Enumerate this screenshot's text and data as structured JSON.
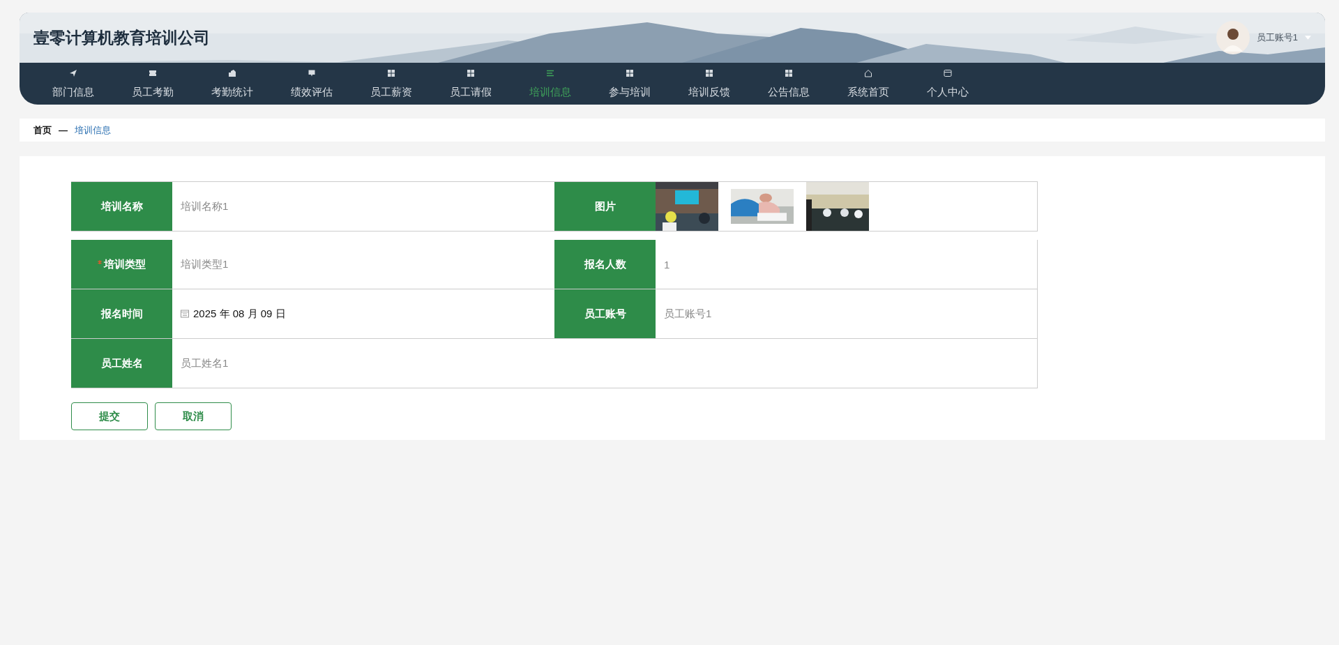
{
  "header": {
    "title": "壹零计算机教育培训公司",
    "user": {
      "name": "员工账号1"
    }
  },
  "nav": [
    {
      "label": "部门信息",
      "selected": false
    },
    {
      "label": "员工考勤",
      "selected": false
    },
    {
      "label": "考勤统计",
      "selected": false
    },
    {
      "label": "绩效评估",
      "selected": false
    },
    {
      "label": "员工薪资",
      "selected": false
    },
    {
      "label": "员工请假",
      "selected": false
    },
    {
      "label": "培训信息",
      "selected": true
    },
    {
      "label": "参与培训",
      "selected": false
    },
    {
      "label": "培训反馈",
      "selected": false
    },
    {
      "label": "公告信息",
      "selected": false
    },
    {
      "label": "系统首页",
      "selected": false
    },
    {
      "label": "个人中心",
      "selected": false
    }
  ],
  "breadcrumb": [
    "首页",
    "—",
    "培训信息"
  ],
  "form": {
    "fields": [
      {
        "kind": "text",
        "label": "培训名称",
        "value": "培训名称1",
        "disabled": true,
        "required": false
      },
      {
        "kind": "images",
        "label": "图片"
      },
      {
        "kind": "text",
        "label": "培训类型",
        "value": "培训类型1",
        "disabled": true,
        "required": true
      },
      {
        "kind": "text",
        "label": "报名人数",
        "value": "1",
        "disabled": true,
        "required": false
      },
      {
        "kind": "date",
        "label": "报名时间",
        "value": "2025 年 08 月 09 日",
        "disabled": false,
        "required": false
      },
      {
        "kind": "text",
        "label": "员工账号",
        "value": "员工账号1",
        "disabled": true,
        "required": false
      },
      {
        "kind": "text",
        "label": "员工姓名",
        "value": "员工姓名1",
        "disabled": true,
        "required": false
      }
    ],
    "buttons": [
      "提交",
      "取消"
    ]
  }
}
